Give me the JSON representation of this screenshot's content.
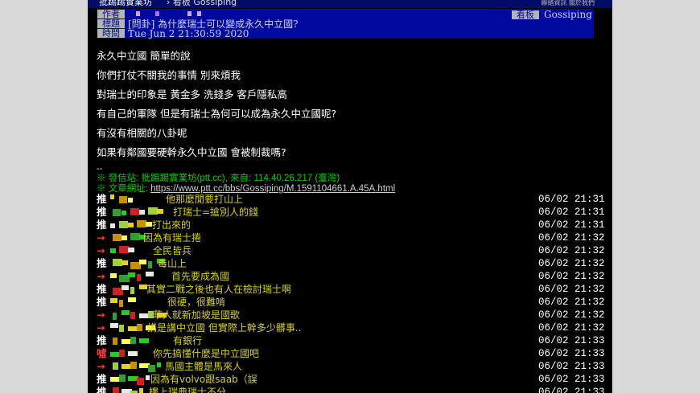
{
  "topbar": {
    "board_name": "批踢踢實業坊",
    "crumb": "› 看板 Gossiping",
    "right_links": "聯絡資訊  關於我們"
  },
  "header": {
    "author_label": "作者",
    "title_label": "標題",
    "time_label": "時間",
    "board_label": "看板",
    "board_value": "Gossiping",
    "title_value": "[問卦] 為什麼瑞士可以變成永久中立國?",
    "time_value": "Tue Jun  2 21:30:59 2020"
  },
  "body": {
    "paragraphs": [
      "永久中立國 簡單的說",
      "你們打仗不關我的事情 別來煩我",
      "對瑞士的印象是 黃金多 洗錢多 客戶隱私高",
      "有自己的軍隊 但是有瑞士為何可以成為永久中立國呢?",
      "有沒有相關的八卦呢",
      "如果有鄰國要硬幹永久中立國 會被制裁嗎?"
    ],
    "separator": "--"
  },
  "signature": {
    "sent_from": "※ 發信站: 批踢踢實業坊(ptt.cc), 來自: 114.40.26.217 (臺灣)",
    "url_prefix": "※ 文章網址: ",
    "url": "https://www.ptt.cc/bbs/Gossiping/M.1591104661.A.45A.html"
  },
  "pushes": [
    {
      "tag": "推",
      "type": "push",
      "text": "他那麼閒要打山上",
      "time": "06/02 21:31"
    },
    {
      "tag": "推",
      "type": "push",
      "text": "打瑞士=搶別人的錢",
      "time": "06/02 21:31"
    },
    {
      "tag": "推",
      "type": "push",
      "text": "打出來的",
      "time": "06/02 21:31"
    },
    {
      "tag": "→",
      "type": "arrow",
      "text": "因為有瑞士捲",
      "time": "06/02 21:32"
    },
    {
      "tag": "→",
      "type": "arrow",
      "text": "全民皆兵",
      "time": "06/02 21:32"
    },
    {
      "tag": "推",
      "type": "push",
      "text": "毒山上",
      "time": "06/02 21:32"
    },
    {
      "tag": "→",
      "type": "arrow",
      "text": "首先要成為國",
      "time": "06/02 21:32"
    },
    {
      "tag": "推",
      "type": "push",
      "text": "其實二戰之後也有人在檢討瑞士啊",
      "time": "06/02 21:32"
    },
    {
      "tag": "推",
      "type": "push",
      "text": "很硬，很難啃",
      "time": "06/02 21:32"
    },
    {
      "tag": "→",
      "type": "arrow",
      "text": ": 華人就新加坡是國歌",
      "time": "06/02 21:32"
    },
    {
      "tag": "→",
      "type": "arrow",
      "text": "講是講中立國 但實際上幹多少髒事..",
      "time": "06/02 21:32"
    },
    {
      "tag": "推",
      "type": "push",
      "text": "有銀行",
      "time": "06/02 21:33"
    },
    {
      "tag": "噓",
      "type": "boo",
      "text": "你先搞懂什麼是中立國吧",
      "time": "06/02 21:33"
    },
    {
      "tag": "→",
      "type": "arrow",
      "text": "馬國主體是馬來人",
      "time": "06/02 21:33"
    },
    {
      "tag": "推",
      "type": "push",
      "text": "因為有volvo跟saab（誤",
      "time": "06/02 21:33"
    },
    {
      "tag": "推",
      "type": "push",
      "text": "樓上瑞典瑞士不分",
      "time": "06/02 21:33"
    }
  ],
  "colors": {
    "page_bg": "#000000",
    "header_bg": "#000a9e",
    "push_text": "#d8d020",
    "info_green": "#00d000",
    "arrow_red": "#ff3c3c"
  }
}
